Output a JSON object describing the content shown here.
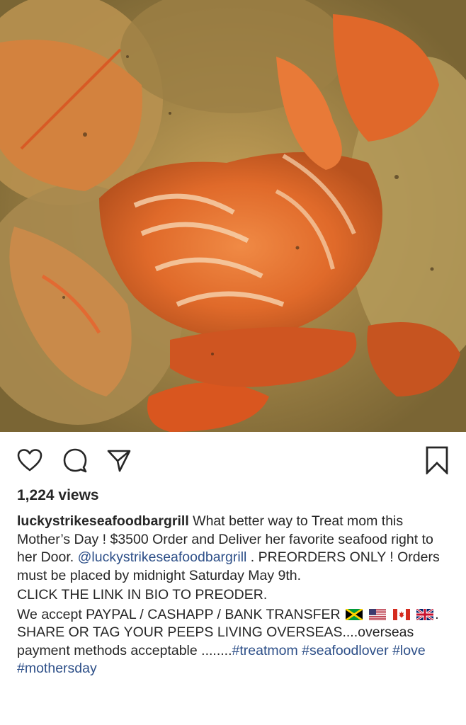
{
  "post": {
    "photo_icon": "seafood-photo"
  },
  "actions": {
    "like_icon": "heart-icon",
    "comment_icon": "comment-icon",
    "share_icon": "paper-plane-icon",
    "save_icon": "bookmark-icon"
  },
  "stats": {
    "views": "1,224 views"
  },
  "caption": {
    "username": "luckystrikeseafoodbargrill",
    "text_1": " What better way to Treat mom this Mother’s Day ! $3500 Order and Deliver her favorite seafood right to her Door. ",
    "mention": "@luckystrikeseafoodbargrill",
    "text_2": " . PREORDERS ONLY ! Orders must be placed by midnight Saturday May 9th.",
    "line_2": "CLICK THE LINK IN BIO TO PREODER.",
    "line_3_a": "We accept PAYPAL / CASHAPP / BANK TRANSFER",
    "line_3_b": ". SHARE OR TAG YOUR PEEPS LIVING OVERSEAS....overseas payment methods acceptable ........",
    "hashtags": [
      "#treatmom",
      "#seafoodlover",
      "#love",
      "#mothersday"
    ],
    "flags": [
      "jamaica-flag",
      "usa-flag",
      "canada-flag",
      "uk-flag"
    ]
  }
}
